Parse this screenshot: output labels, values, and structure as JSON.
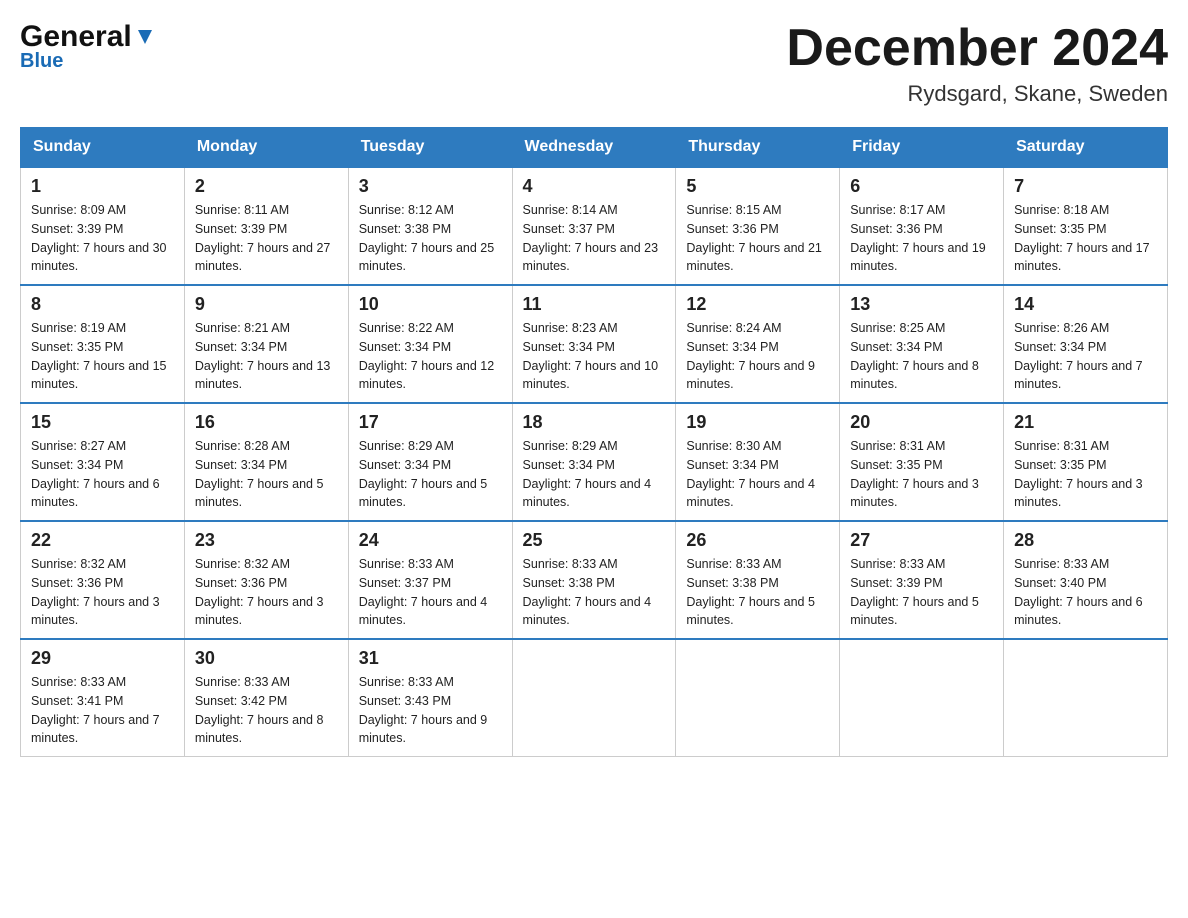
{
  "header": {
    "logo_general": "General",
    "logo_blue": "Blue",
    "month_title": "December 2024",
    "location": "Rydsgard, Skane, Sweden"
  },
  "weekdays": [
    "Sunday",
    "Monday",
    "Tuesday",
    "Wednesday",
    "Thursday",
    "Friday",
    "Saturday"
  ],
  "weeks": [
    [
      {
        "day": "1",
        "sunrise": "Sunrise: 8:09 AM",
        "sunset": "Sunset: 3:39 PM",
        "daylight": "Daylight: 7 hours and 30 minutes."
      },
      {
        "day": "2",
        "sunrise": "Sunrise: 8:11 AM",
        "sunset": "Sunset: 3:39 PM",
        "daylight": "Daylight: 7 hours and 27 minutes."
      },
      {
        "day": "3",
        "sunrise": "Sunrise: 8:12 AM",
        "sunset": "Sunset: 3:38 PM",
        "daylight": "Daylight: 7 hours and 25 minutes."
      },
      {
        "day": "4",
        "sunrise": "Sunrise: 8:14 AM",
        "sunset": "Sunset: 3:37 PM",
        "daylight": "Daylight: 7 hours and 23 minutes."
      },
      {
        "day": "5",
        "sunrise": "Sunrise: 8:15 AM",
        "sunset": "Sunset: 3:36 PM",
        "daylight": "Daylight: 7 hours and 21 minutes."
      },
      {
        "day": "6",
        "sunrise": "Sunrise: 8:17 AM",
        "sunset": "Sunset: 3:36 PM",
        "daylight": "Daylight: 7 hours and 19 minutes."
      },
      {
        "day": "7",
        "sunrise": "Sunrise: 8:18 AM",
        "sunset": "Sunset: 3:35 PM",
        "daylight": "Daylight: 7 hours and 17 minutes."
      }
    ],
    [
      {
        "day": "8",
        "sunrise": "Sunrise: 8:19 AM",
        "sunset": "Sunset: 3:35 PM",
        "daylight": "Daylight: 7 hours and 15 minutes."
      },
      {
        "day": "9",
        "sunrise": "Sunrise: 8:21 AM",
        "sunset": "Sunset: 3:34 PM",
        "daylight": "Daylight: 7 hours and 13 minutes."
      },
      {
        "day": "10",
        "sunrise": "Sunrise: 8:22 AM",
        "sunset": "Sunset: 3:34 PM",
        "daylight": "Daylight: 7 hours and 12 minutes."
      },
      {
        "day": "11",
        "sunrise": "Sunrise: 8:23 AM",
        "sunset": "Sunset: 3:34 PM",
        "daylight": "Daylight: 7 hours and 10 minutes."
      },
      {
        "day": "12",
        "sunrise": "Sunrise: 8:24 AM",
        "sunset": "Sunset: 3:34 PM",
        "daylight": "Daylight: 7 hours and 9 minutes."
      },
      {
        "day": "13",
        "sunrise": "Sunrise: 8:25 AM",
        "sunset": "Sunset: 3:34 PM",
        "daylight": "Daylight: 7 hours and 8 minutes."
      },
      {
        "day": "14",
        "sunrise": "Sunrise: 8:26 AM",
        "sunset": "Sunset: 3:34 PM",
        "daylight": "Daylight: 7 hours and 7 minutes."
      }
    ],
    [
      {
        "day": "15",
        "sunrise": "Sunrise: 8:27 AM",
        "sunset": "Sunset: 3:34 PM",
        "daylight": "Daylight: 7 hours and 6 minutes."
      },
      {
        "day": "16",
        "sunrise": "Sunrise: 8:28 AM",
        "sunset": "Sunset: 3:34 PM",
        "daylight": "Daylight: 7 hours and 5 minutes."
      },
      {
        "day": "17",
        "sunrise": "Sunrise: 8:29 AM",
        "sunset": "Sunset: 3:34 PM",
        "daylight": "Daylight: 7 hours and 5 minutes."
      },
      {
        "day": "18",
        "sunrise": "Sunrise: 8:29 AM",
        "sunset": "Sunset: 3:34 PM",
        "daylight": "Daylight: 7 hours and 4 minutes."
      },
      {
        "day": "19",
        "sunrise": "Sunrise: 8:30 AM",
        "sunset": "Sunset: 3:34 PM",
        "daylight": "Daylight: 7 hours and 4 minutes."
      },
      {
        "day": "20",
        "sunrise": "Sunrise: 8:31 AM",
        "sunset": "Sunset: 3:35 PM",
        "daylight": "Daylight: 7 hours and 3 minutes."
      },
      {
        "day": "21",
        "sunrise": "Sunrise: 8:31 AM",
        "sunset": "Sunset: 3:35 PM",
        "daylight": "Daylight: 7 hours and 3 minutes."
      }
    ],
    [
      {
        "day": "22",
        "sunrise": "Sunrise: 8:32 AM",
        "sunset": "Sunset: 3:36 PM",
        "daylight": "Daylight: 7 hours and 3 minutes."
      },
      {
        "day": "23",
        "sunrise": "Sunrise: 8:32 AM",
        "sunset": "Sunset: 3:36 PM",
        "daylight": "Daylight: 7 hours and 3 minutes."
      },
      {
        "day": "24",
        "sunrise": "Sunrise: 8:33 AM",
        "sunset": "Sunset: 3:37 PM",
        "daylight": "Daylight: 7 hours and 4 minutes."
      },
      {
        "day": "25",
        "sunrise": "Sunrise: 8:33 AM",
        "sunset": "Sunset: 3:38 PM",
        "daylight": "Daylight: 7 hours and 4 minutes."
      },
      {
        "day": "26",
        "sunrise": "Sunrise: 8:33 AM",
        "sunset": "Sunset: 3:38 PM",
        "daylight": "Daylight: 7 hours and 5 minutes."
      },
      {
        "day": "27",
        "sunrise": "Sunrise: 8:33 AM",
        "sunset": "Sunset: 3:39 PM",
        "daylight": "Daylight: 7 hours and 5 minutes."
      },
      {
        "day": "28",
        "sunrise": "Sunrise: 8:33 AM",
        "sunset": "Sunset: 3:40 PM",
        "daylight": "Daylight: 7 hours and 6 minutes."
      }
    ],
    [
      {
        "day": "29",
        "sunrise": "Sunrise: 8:33 AM",
        "sunset": "Sunset: 3:41 PM",
        "daylight": "Daylight: 7 hours and 7 minutes."
      },
      {
        "day": "30",
        "sunrise": "Sunrise: 8:33 AM",
        "sunset": "Sunset: 3:42 PM",
        "daylight": "Daylight: 7 hours and 8 minutes."
      },
      {
        "day": "31",
        "sunrise": "Sunrise: 8:33 AM",
        "sunset": "Sunset: 3:43 PM",
        "daylight": "Daylight: 7 hours and 9 minutes."
      },
      null,
      null,
      null,
      null
    ]
  ]
}
